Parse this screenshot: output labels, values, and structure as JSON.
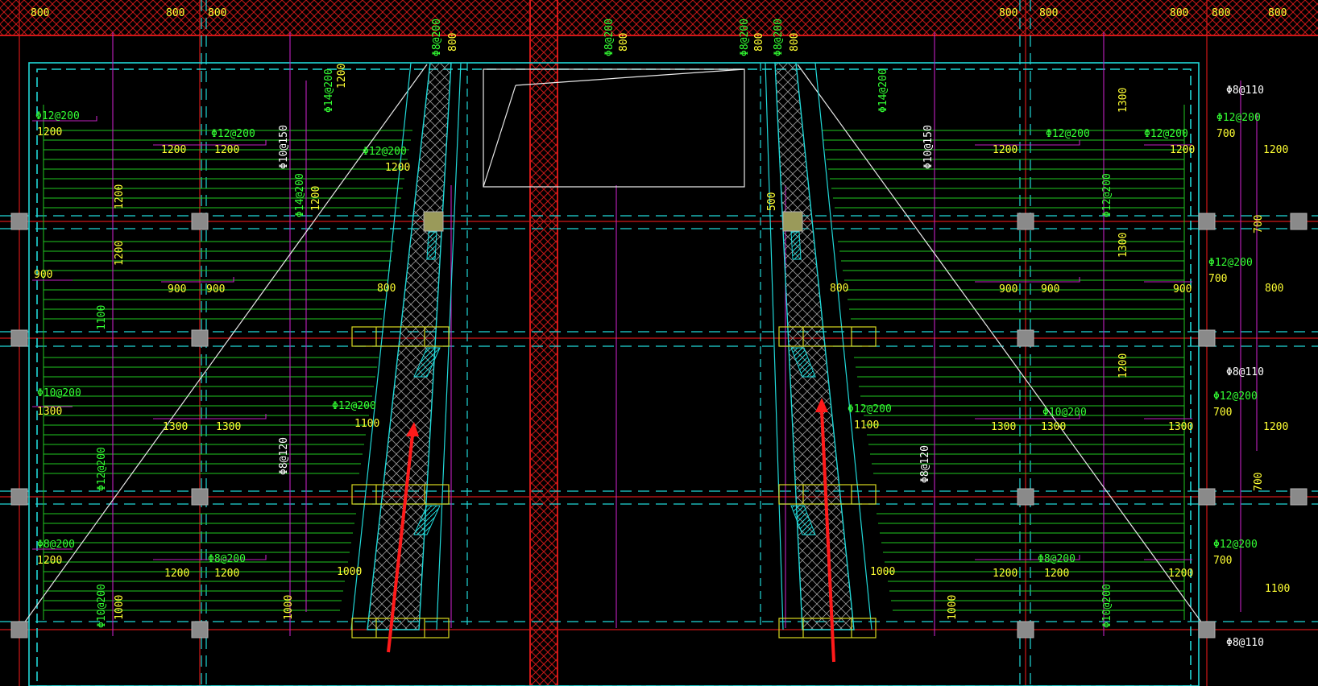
{
  "drawing": {
    "colors": {
      "background": "#000000",
      "axis_red": "#d01818",
      "hatch_red": "#c81818",
      "beam_cyan": "#20d8d8",
      "rebar_green": "#20e020",
      "dim_magenta": "#c020c0",
      "text_yellow": "#ffff33",
      "text_green": "#33ff33",
      "column_gray": "#8a8a8a",
      "arrow_red": "#ff1a1a",
      "outline_white": "#e8e8e8"
    },
    "top_dims": [
      "800",
      "800",
      "800",
      "800",
      "800",
      "800",
      "800",
      "800",
      "800",
      "800",
      "800",
      "800"
    ],
    "left_labels": {
      "r1": "Φ12@200",
      "r1b": "1200",
      "r2": "Φ12@200",
      "r2b": "1200",
      "r2c": "1200",
      "r3": "Φ12@200",
      "r3b": "1200",
      "r4": "Φ10@150",
      "r5": "Φ14@200",
      "r5b": "1200",
      "r6": "Φ14@200",
      "r6b": "1200",
      "r7": "900",
      "r8": "900",
      "r8b": "900",
      "r9": "Φ10@200",
      "r9b": "1300",
      "r10": "1300",
      "r10b": "1300",
      "r11": "Φ12@200",
      "r11b": "1100",
      "r12": "Φ8@200",
      "r12b": "1200",
      "r13": "Φ8@200",
      "r13b": "1200",
      "r14": "1200",
      "r15": "Φ8@120",
      "r16": "Φ10@200",
      "r16b": "1000",
      "r17": "1000",
      "r18": "Φ12@200",
      "r19": "800",
      "r20": "1100",
      "r21": "1000",
      "r22": "1200",
      "r23": "1200"
    },
    "right_labels": {
      "l1": "Φ8@110",
      "l2": "Φ12@200",
      "l3": "700",
      "l4": "1200",
      "l5": "Φ12@200",
      "l6": "1200",
      "l7": "Φ12@200",
      "l8": "1200",
      "l9": "Φ10@150",
      "l10": "Φ14@200",
      "l11": "1300",
      "l12": "Φ12@200",
      "l13": "1300",
      "l14": "800",
      "l15": "900",
      "l16": "900",
      "l17": "900",
      "l18": "Φ12@200",
      "l19": "700",
      "l20": "800",
      "l21": "Φ8@110",
      "l22": "Φ12@200",
      "l23": "700",
      "l24": "Φ10@200",
      "l25": "1300",
      "l26": "1300",
      "l27": "1300",
      "l28": "Φ12@200",
      "l29": "1100",
      "l30": "1200",
      "l31": "Φ8@120",
      "l32": "Φ12@200",
      "l33": "700",
      "l34": "Φ8@200",
      "l35": "1200",
      "l36": "1200",
      "l37": "1000",
      "l38": "1100",
      "l39": "Φ8@110",
      "l40": "1000",
      "l41": "1200",
      "l42": "700",
      "l43": "1200",
      "l44": "700",
      "l45": "Φ10@200",
      "l46": "500"
    },
    "misc_labels": {
      "m1": "Φ8@200",
      "m2": "Φ8@200",
      "m3": "Φ8@200",
      "m4": "Φ8@200",
      "m5": "800",
      "m6": "800",
      "m7": "800",
      "m8": "800"
    }
  }
}
